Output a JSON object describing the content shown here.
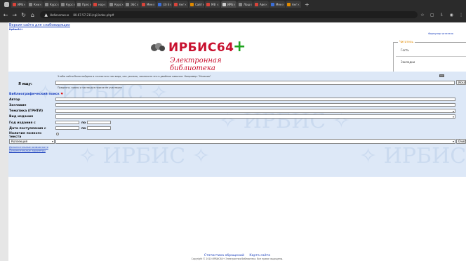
{
  "browser": {
    "tabs": [
      {
        "title": "ИРБ",
        "color": "#d9443a"
      },
      {
        "title": "Кни",
        "color": "#888888"
      },
      {
        "title": "Курс",
        "color": "#888888"
      },
      {
        "title": "Курс",
        "color": "#888888"
      },
      {
        "title": "Прес",
        "color": "#888888"
      },
      {
        "title": "нор",
        "color": "#d9443a"
      },
      {
        "title": "Курс",
        "color": "#888888"
      },
      {
        "title": "ЭБС",
        "color": "#888888"
      },
      {
        "title": "Мен",
        "color": "#d9443a"
      },
      {
        "title": "(3) Е",
        "color": "#3b6fd9"
      },
      {
        "title": "Анг",
        "color": "#d9443a"
      },
      {
        "title": "Сайт",
        "color": "#e08a00"
      },
      {
        "title": "МВ",
        "color": "#d9443a"
      },
      {
        "title": "ИРБ",
        "color": "#cccccc"
      },
      {
        "title": "Лош",
        "color": "#888888"
      },
      {
        "title": "Аве",
        "color": "#d9443a"
      },
      {
        "title": "Мен",
        "color": "#3b6fd9"
      },
      {
        "title": "Анг",
        "color": "#e08a00"
      }
    ],
    "security_label": "Небезопасно",
    "url": "80.67.57.211/cgi/index.php#"
  },
  "page": {
    "visually_impaired_link": "Версия сайта для слабовидящих",
    "irbis_label": "Ирбис64+",
    "reader_card_link": "Формуляр читателя",
    "logo": {
      "name": "ИРБИС64",
      "plus": "+",
      "subtitle": "Электронная библиотека"
    },
    "reader": {
      "legend": "Читатель",
      "guest": "Гость",
      "bookmarks": "Закладки"
    },
    "search": {
      "hint_top": "Чтобы найти было найдено в точности в том виде, как указано, заключите его в двойные кавычки. Например: \"Казахия\"",
      "i_search_label": "Я ищу:",
      "search_button": "Искать",
      "hint_bottom": "Предлоги, союзы и частицы в поиске не участвуют",
      "biblio_label": "Библиографический поиск",
      "fields": [
        {
          "label": "Автор"
        },
        {
          "label": "Заглавие"
        },
        {
          "label": "Тематика (ГРНТИ)"
        },
        {
          "label": "Вид издания"
        }
      ],
      "year_label": "Год издания с",
      "date_label": "Дата поступления с",
      "po": "по",
      "fulltext_label": "Наличие полного текста",
      "collection_value": "Коллекция",
      "clear_button": "Очистить",
      "advanced_link": "Дополнительные возможности",
      "extra_params_link": "Дополнительные параметры"
    },
    "footer": {
      "stats_link": "Статистика обращений",
      "sitemap_link": "Карта сайта",
      "copyright": "Copyright © 2010 ИРБИС64+ Электронная библиотека. Все права защищены."
    }
  }
}
